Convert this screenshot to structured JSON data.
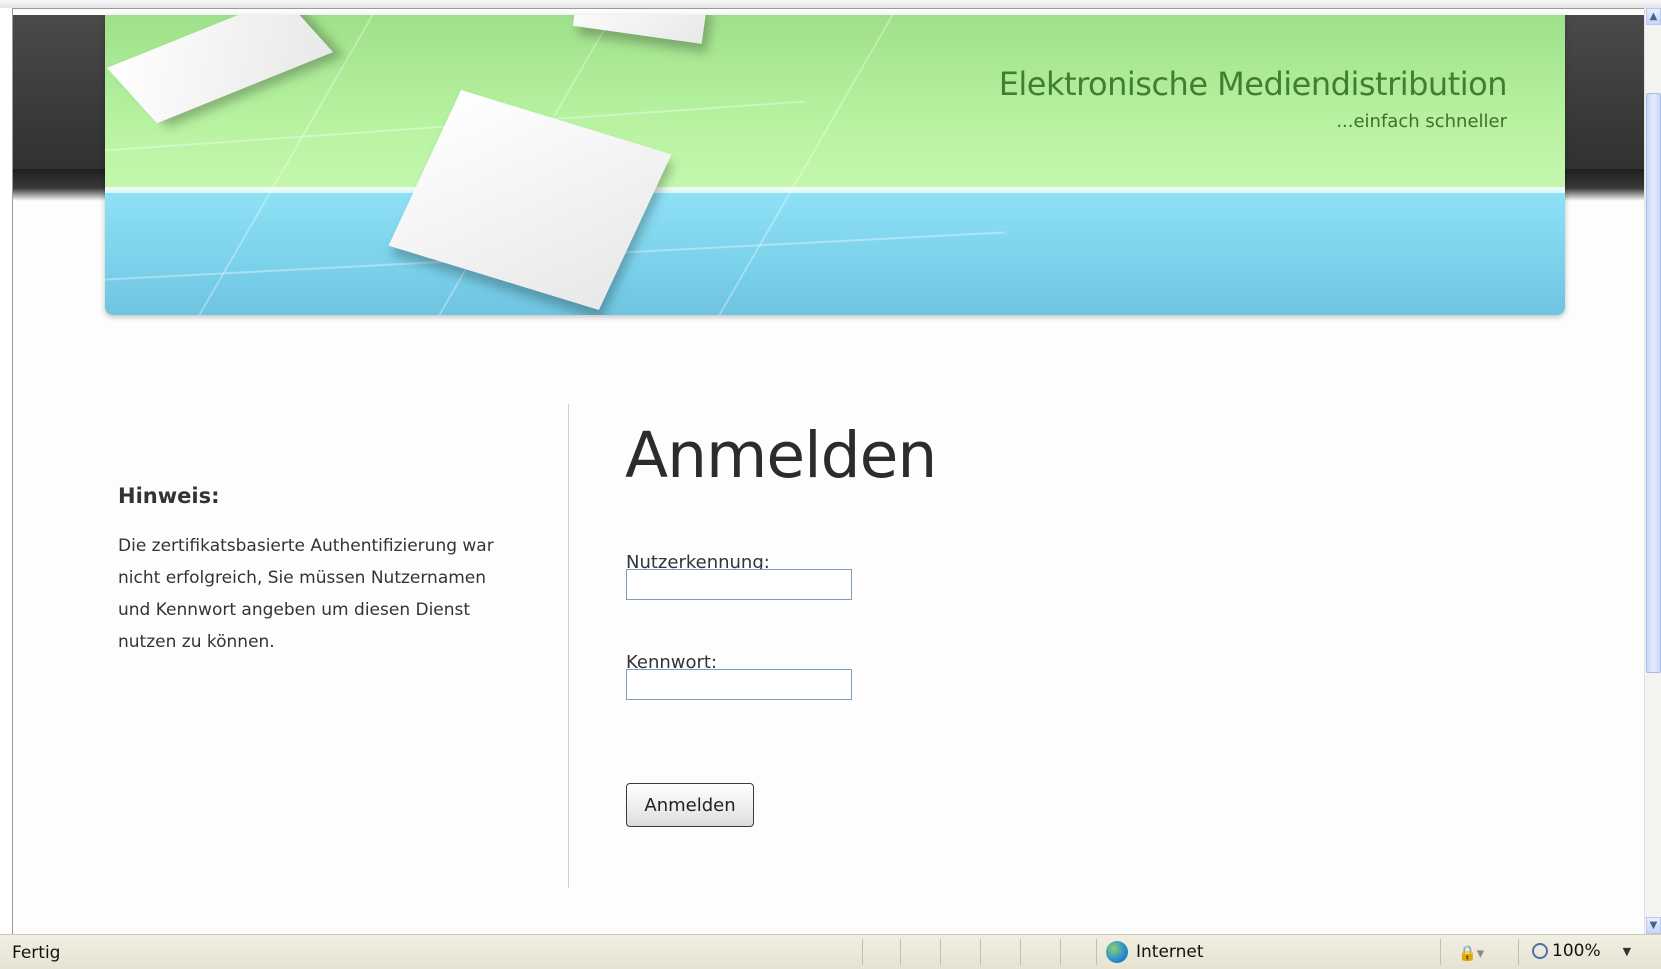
{
  "banner": {
    "title": "Elektronische Mediendistribution",
    "subtitle": "...einfach schneller"
  },
  "notice": {
    "heading": "Hinweis:",
    "lines": [
      "Die zertifikatsbasierte Authentifizierung war",
      "nicht erfolgreich, Sie müssen Nutzernamen",
      "und Kennwort angeben um diesen Dienst",
      "nutzen zu können."
    ]
  },
  "login": {
    "title": "Anmelden",
    "username_label": "Nutzerkennung:",
    "username_value": "",
    "password_label": "Kennwort:",
    "password_value": "",
    "submit_label": "Anmelden"
  },
  "statusbar": {
    "status": "Fertig",
    "zone": "Internet",
    "zoom": "100%"
  },
  "icons": {
    "zone_icon": "globe-icon",
    "protected_mode_icon": "lock-icon",
    "zoom_icon": "magnifier-icon"
  }
}
